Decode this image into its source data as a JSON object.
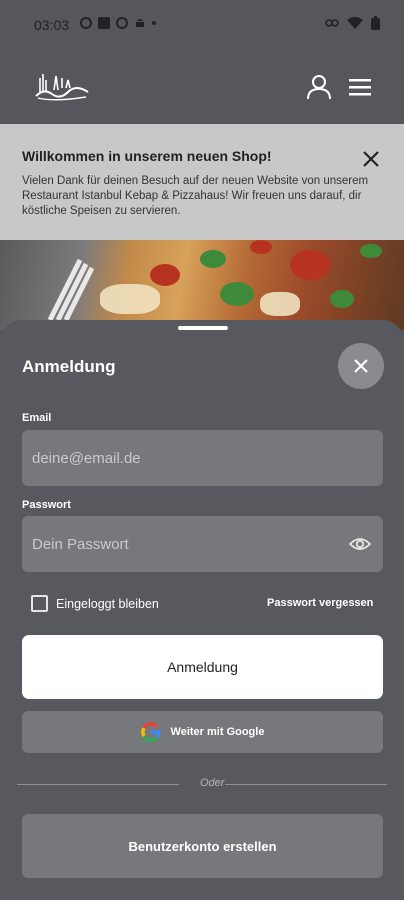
{
  "status_bar": {
    "time": "03:03",
    "left_icons": [
      "app-icon",
      "square-icon",
      "sync-icon",
      "android-icon",
      "dot-icon"
    ],
    "right_icons": [
      "link-icon",
      "wifi-icon",
      "battery-icon"
    ]
  },
  "header": {
    "logo_icon": "restaurant-logo",
    "user_icon": "user-icon",
    "menu_icon": "menu-icon"
  },
  "banner": {
    "title": "Willkommen in unserem neuen Shop!",
    "text": "Vielen Dank für deinen Besuch auf der neuen Website von unserem Restaurant Istanbul Kebap & Pizzahaus! Wir freuen uns darauf, dir köstliche Speisen zu servieren.",
    "close_icon": "close-icon"
  },
  "login_sheet": {
    "title": "Anmeldung",
    "close_icon": "close-icon",
    "email_label": "Email",
    "email_placeholder": "deine@email.de",
    "email_value": "",
    "password_label": "Passwort",
    "password_placeholder": "Dein Passwort",
    "password_value": "",
    "show_password_icon": "eye-icon",
    "remember_label": "Eingeloggt bleiben",
    "remember_checked": false,
    "forgot_label": "Passwort vergessen",
    "login_label": "Anmeldung",
    "google_label": "Weiter mit Google",
    "divider_text": "Oder",
    "register_label": "Benutzerkonto erstellen"
  },
  "colors": {
    "background": "#55575c",
    "banner": "#c8c8c8",
    "input": "#77787c",
    "primary_button": "#ffffff"
  }
}
